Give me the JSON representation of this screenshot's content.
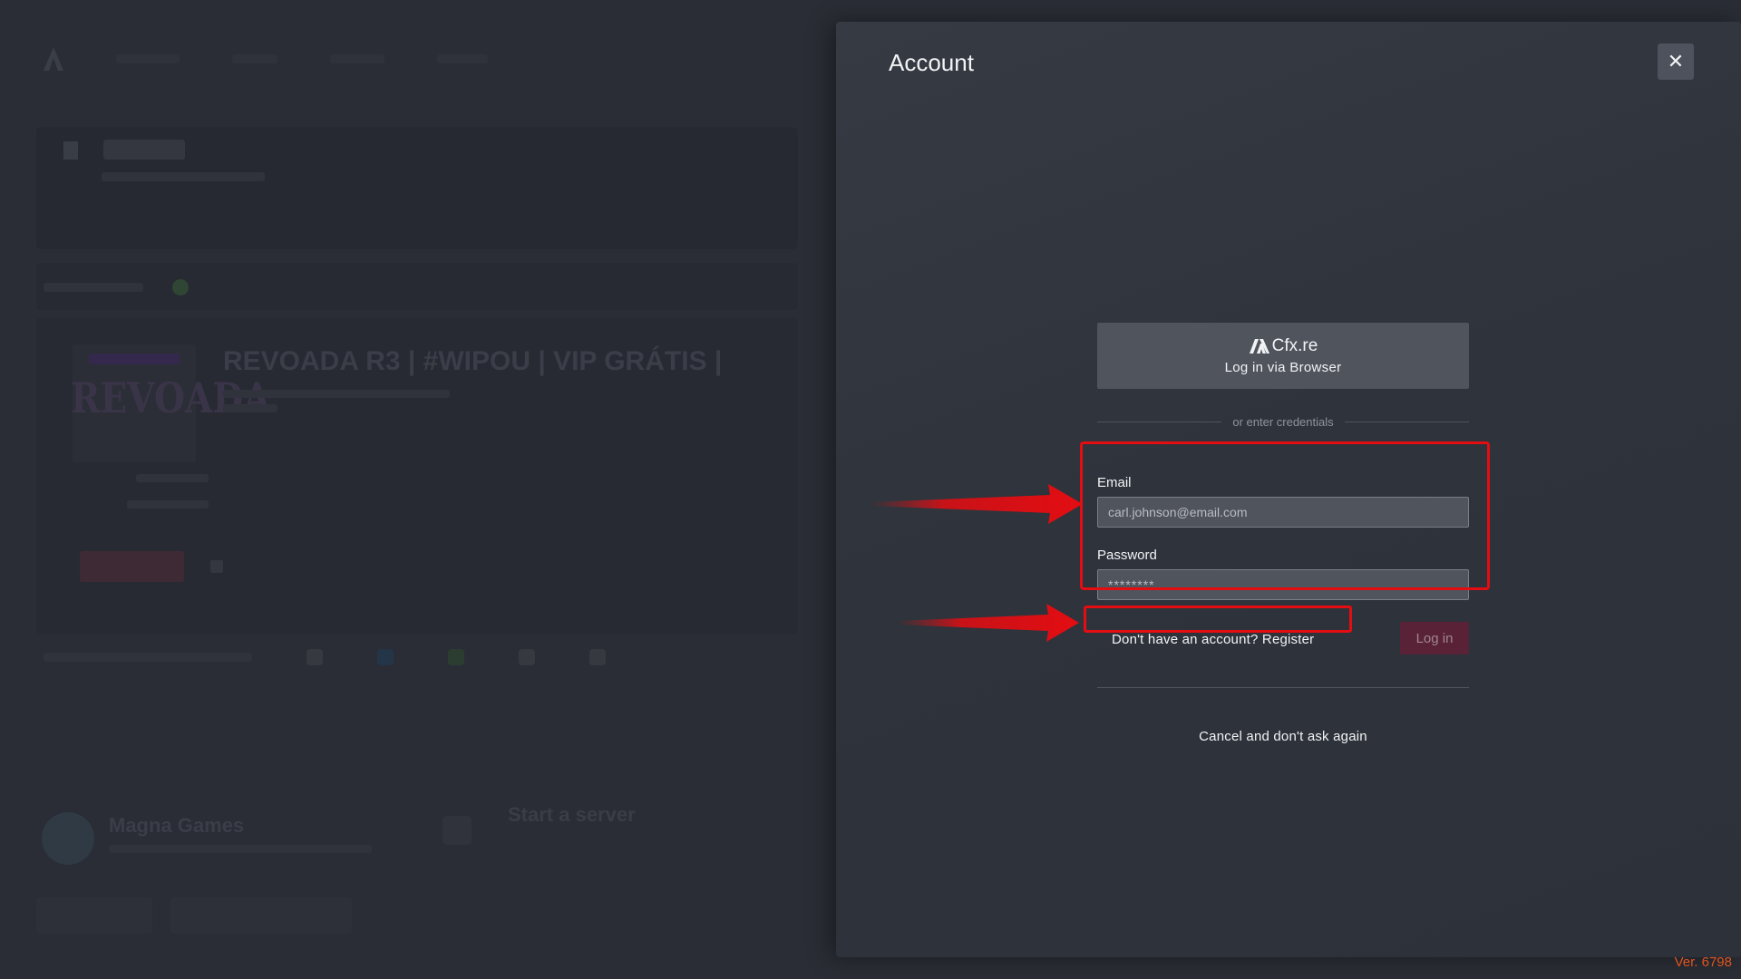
{
  "background_app": {
    "server_title": "REVOADA R3 | #WIPOU | VIP GRÁTIS |",
    "server_logo": "REVOADA",
    "footer_name": "Magna Games",
    "footer_title": "Start a server"
  },
  "modal": {
    "title": "Account",
    "close_label": "✕",
    "cfx": {
      "logo_text": "Cfx.re",
      "button_label": "Log in via Browser"
    },
    "divider_text": "or enter credentials",
    "email": {
      "label": "Email",
      "placeholder": "carl.johnson@email.com"
    },
    "password": {
      "label": "Password",
      "placeholder": "********"
    },
    "register_link": "Don't have an account? Register",
    "login_button": "Log in",
    "cancel_link": "Cancel and don't ask again"
  },
  "version": "Ver. 6798",
  "colors": {
    "annotation_red": "#e30d12",
    "login_button_bg": "#5a2236",
    "version_orange": "#e0541e"
  }
}
